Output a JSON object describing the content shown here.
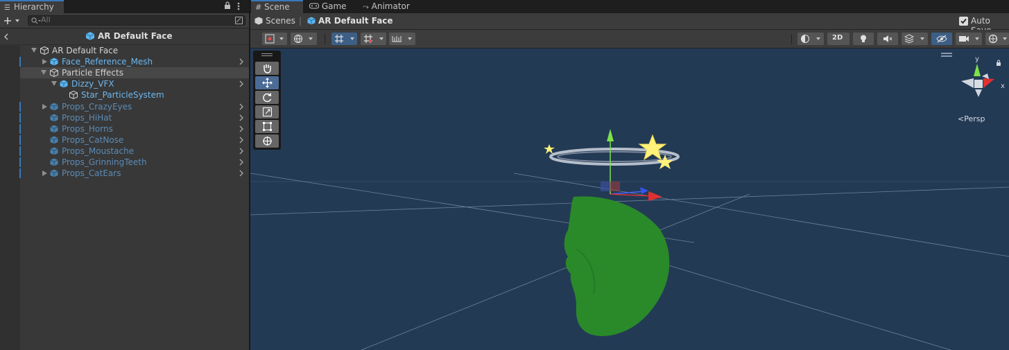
{
  "hierarchy": {
    "tab_label": "Hierarchy",
    "search_placeholder": "All",
    "header_title": "AR Default Face",
    "items": [
      {
        "label": "AR Default Face"
      },
      {
        "label": "Face_Reference_Mesh"
      },
      {
        "label": "Particle Effects"
      },
      {
        "label": "Dizzy_VFX"
      },
      {
        "label": "Star_ParticleSystem"
      },
      {
        "label": "Props_CrazyEyes"
      },
      {
        "label": "Props_HiHat"
      },
      {
        "label": "Props_Horns"
      },
      {
        "label": "Props_CatNose"
      },
      {
        "label": "Props_Moustache"
      },
      {
        "label": "Props_GrinningTeeth"
      },
      {
        "label": "Props_CatEars"
      }
    ]
  },
  "scene": {
    "tabs": [
      {
        "label": "Scene"
      },
      {
        "label": "Game"
      },
      {
        "label": "Animator"
      }
    ],
    "breadcrumb_root": "Scenes",
    "breadcrumb_current": "AR Default Face",
    "auto_save_label": "Auto Save",
    "auto_save_checked": true,
    "toggle_2d": "2D",
    "persp_label": "Persp",
    "gizmo_y": "y",
    "gizmo_x": "x"
  },
  "colors": {
    "accent": "#3a79bb",
    "prefab_text": "#6db7ef",
    "viewport_bg": "#233a55",
    "face_mesh": "#2a8a2a"
  }
}
